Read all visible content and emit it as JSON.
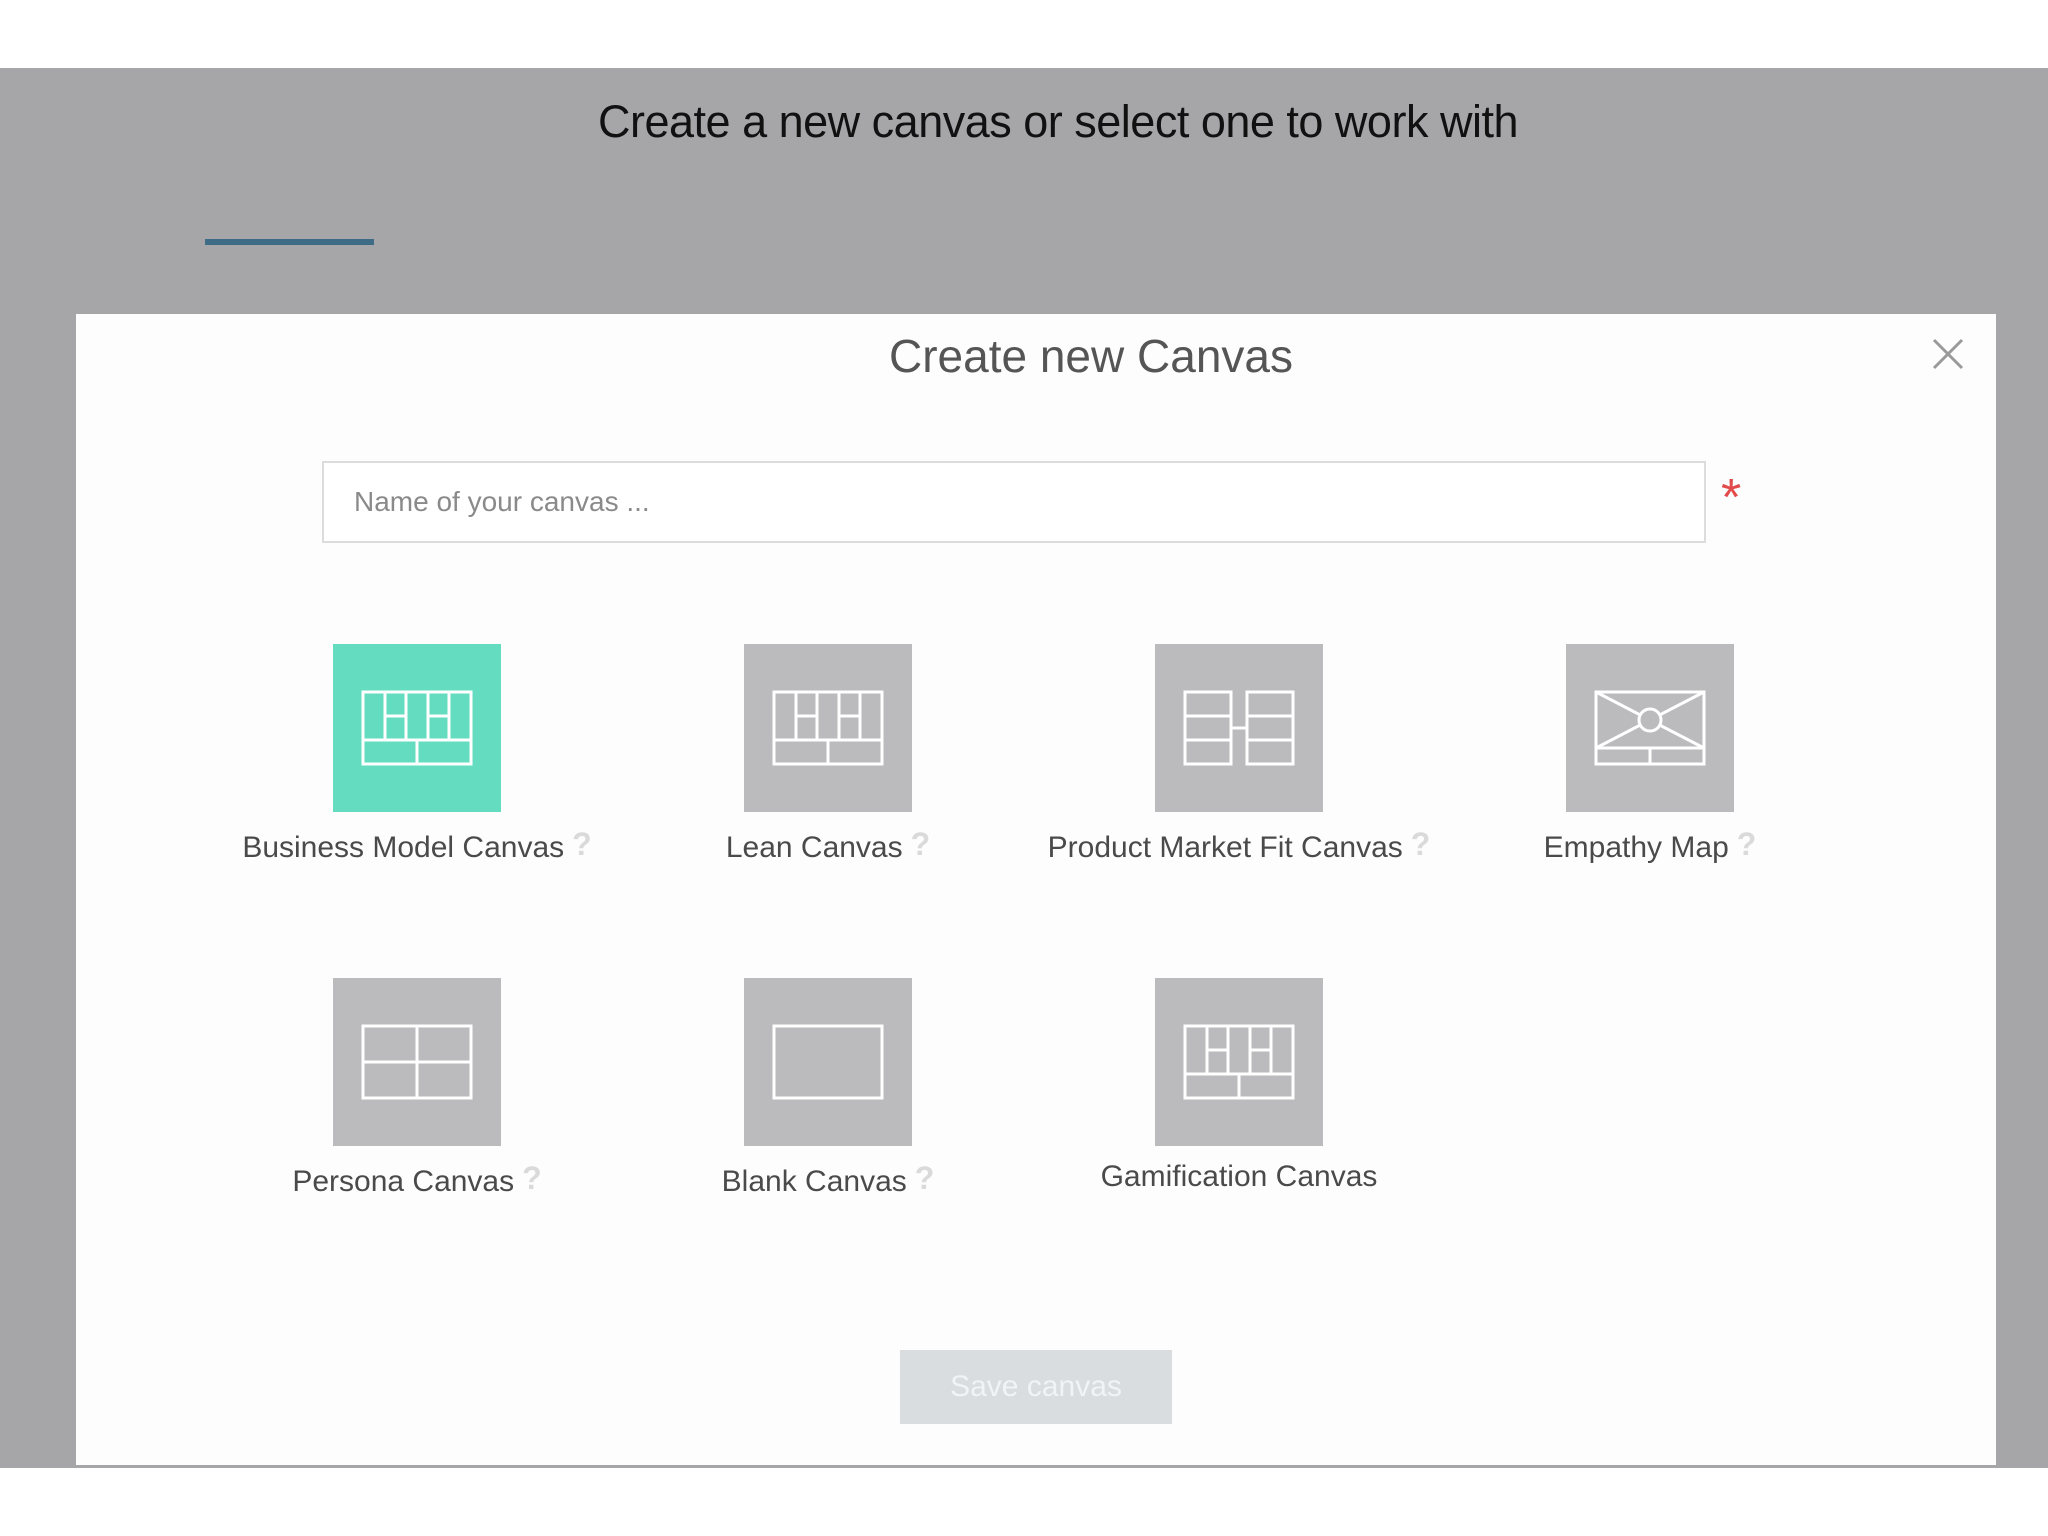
{
  "page": {
    "heading": "Create a new canvas or select one to work with"
  },
  "modal": {
    "title": "Create new Canvas",
    "close_icon": "close-icon",
    "name_input": {
      "value": "",
      "placeholder": "Name of your canvas ..."
    },
    "required_marker": "*",
    "templates": [
      {
        "label": "Business Model Canvas",
        "help": "?",
        "selected": true,
        "icon": "business-model-canvas-icon"
      },
      {
        "label": "Lean Canvas",
        "help": "?",
        "selected": false,
        "icon": "lean-canvas-icon"
      },
      {
        "label": "Product Market Fit Canvas",
        "help": "?",
        "selected": false,
        "icon": "product-market-fit-canvas-icon"
      },
      {
        "label": "Empathy Map",
        "help": "?",
        "selected": false,
        "icon": "empathy-map-icon"
      },
      {
        "label": "Persona Canvas",
        "help": "?",
        "selected": false,
        "icon": "persona-canvas-icon"
      },
      {
        "label": "Blank Canvas",
        "help": "?",
        "selected": false,
        "icon": "blank-canvas-icon"
      },
      {
        "label": "Gamification Canvas",
        "help": "",
        "selected": false,
        "icon": "gamification-canvas-icon"
      }
    ],
    "save_button": "Save canvas"
  },
  "colors": {
    "backdrop": "#a6a6a8",
    "tab_accent": "#3e6b86",
    "selected_tile": "#64dcc0",
    "tile": "#bbbbbd",
    "required": "#e14b4b",
    "save_disabled": "#d9dde0"
  }
}
